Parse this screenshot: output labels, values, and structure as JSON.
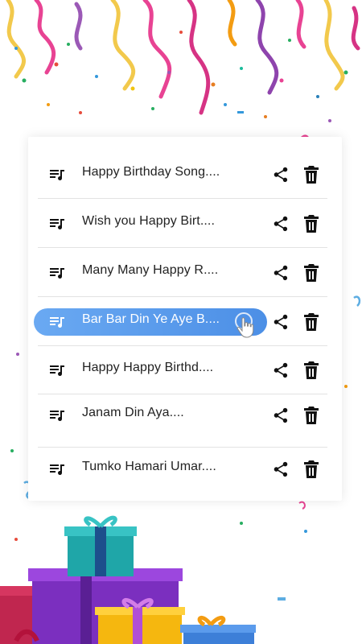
{
  "songs": [
    {
      "title": "Happy Birthday Song...."
    },
    {
      "title": "Wish you Happy Birt...."
    },
    {
      "title": "Many Many Happy R...."
    },
    {
      "title": "Bar Bar Din Ye Aye B...."
    },
    {
      "title": "Happy Happy Birthd...."
    },
    {
      "title": "Janam Din Aya...."
    },
    {
      "title": "Tumko Hamari Umar...."
    }
  ],
  "active_index": 3,
  "icons": {
    "play": "music-playlist-icon",
    "share": "share-icon",
    "delete": "trash-icon",
    "pointer": "hand-pointer-icon"
  },
  "colors": {
    "highlight": "#5b9bec",
    "text": "#222222",
    "divider": "#e2e2e2"
  }
}
